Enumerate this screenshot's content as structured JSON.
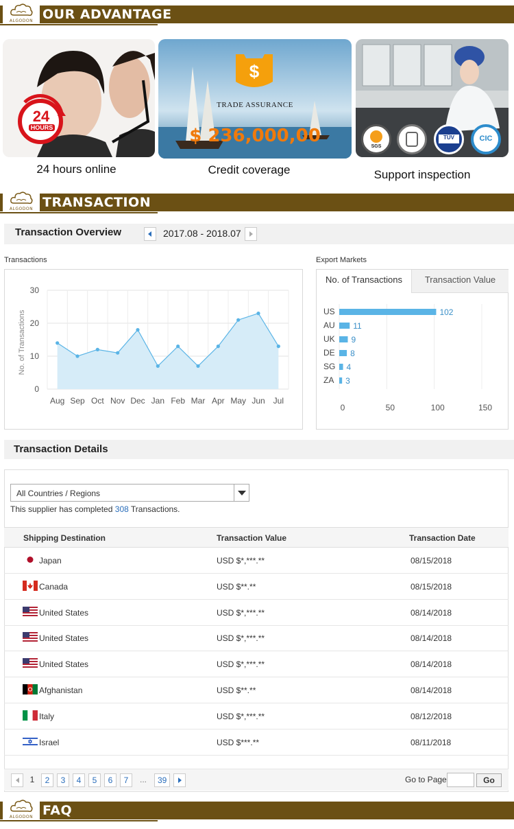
{
  "brand": "ALGODON",
  "sections": {
    "advantage": "OUR ADVANTAGE",
    "transaction": "TRANSACTION",
    "faq": "FAQ"
  },
  "advantages": [
    {
      "caption": "24 hours online",
      "badge_number": "24",
      "badge_text": "HOURS"
    },
    {
      "caption": "Credit coverage",
      "overlay_title": "TRADE ASSURANCE",
      "overlay_amount": "$ 236,000,00"
    },
    {
      "caption": "Support inspection",
      "seals": [
        "SGS",
        "",
        "TÜV",
        "CIC"
      ]
    }
  ],
  "overview": {
    "title": "Transaction Overview",
    "range": "2017.08 - 2018.07"
  },
  "chart_data": [
    {
      "type": "area",
      "title": "Transactions",
      "ylabel": "No. of Transactions",
      "categories": [
        "Aug",
        "Sep",
        "Oct",
        "Nov",
        "Dec",
        "Jan",
        "Feb",
        "Mar",
        "Apr",
        "May",
        "Jun",
        "Jul"
      ],
      "values": [
        14,
        10,
        12,
        11,
        18,
        7,
        13,
        7,
        13,
        21,
        23,
        13
      ],
      "yticks": [
        "0",
        "10",
        "20",
        "30"
      ],
      "ylim": [
        0,
        30
      ],
      "color": "#5ab4e6",
      "fill": "#d6ecf8",
      "grid": true
    },
    {
      "type": "bar",
      "title": "Export Markets",
      "orientation": "horizontal",
      "categories": [
        "US",
        "AU",
        "UK",
        "DE",
        "SG",
        "ZA"
      ],
      "values": [
        102,
        11,
        9,
        8,
        4,
        3
      ],
      "xticks": [
        "0",
        "50",
        "100",
        "150"
      ],
      "xlim": [
        0,
        150
      ],
      "color": "#5ab4e6",
      "grid": true
    }
  ],
  "markets": {
    "tabs": [
      "No. of Transactions",
      "Transaction Value"
    ],
    "active_tab": 0
  },
  "details": {
    "title": "Transaction Details",
    "filter_value": "All Countries / Regions",
    "completed_prefix": "This supplier has completed",
    "completed_count": "308",
    "completed_suffix": "Transactions.",
    "columns": [
      "Shipping Destination",
      "Transaction Value",
      "Transaction Date"
    ],
    "rows": [
      {
        "country": "Japan",
        "flag": "jp",
        "value": "USD $*,***.**",
        "date": "08/15/2018"
      },
      {
        "country": "Canada",
        "flag": "ca",
        "value": "USD $**.**",
        "date": "08/15/2018"
      },
      {
        "country": "United States",
        "flag": "us",
        "value": "USD $*,***.**",
        "date": "08/14/2018"
      },
      {
        "country": "United States",
        "flag": "us",
        "value": "USD $*,***.**",
        "date": "08/14/2018"
      },
      {
        "country": "United States",
        "flag": "us",
        "value": "USD $*,***.**",
        "date": "08/14/2018"
      },
      {
        "country": "Afghanistan",
        "flag": "af",
        "value": "USD $**.**",
        "date": "08/14/2018"
      },
      {
        "country": "Italy",
        "flag": "it",
        "value": "USD $*,***.**",
        "date": "08/12/2018"
      },
      {
        "country": "Israel",
        "flag": "il",
        "value": "USD $***.**",
        "date": "08/11/2018"
      }
    ]
  },
  "pagination": {
    "current": "1",
    "pages": [
      "2",
      "3",
      "4",
      "5",
      "6",
      "7"
    ],
    "ellipsis": "...",
    "last": "39",
    "goto_label": "Go to Page",
    "go_button": "Go"
  }
}
